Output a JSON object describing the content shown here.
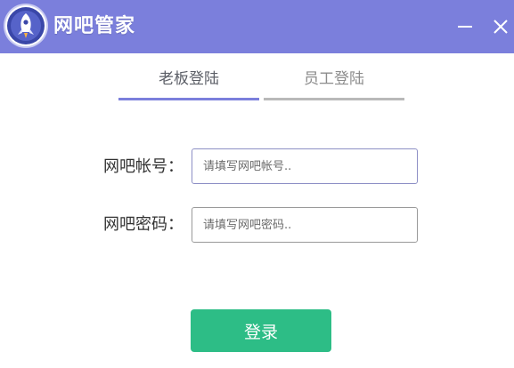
{
  "window": {
    "title": "网吧管家",
    "logo_icon": "rocket-logo-icon",
    "minimize_icon": "minimize-icon",
    "close_icon": "close-icon",
    "titlebar_color": "#7b7fdc"
  },
  "tabs": [
    {
      "label": "老板登陆",
      "active": true
    },
    {
      "label": "员工登陆",
      "active": false
    }
  ],
  "form": {
    "account": {
      "label": "网吧帐号：",
      "value": "",
      "placeholder": "请填写网吧帐号.."
    },
    "password": {
      "label": "网吧密码：",
      "value": "",
      "placeholder": "请填写网吧密码.."
    }
  },
  "login_button": {
    "label": "登录",
    "color": "#2dbd86"
  }
}
